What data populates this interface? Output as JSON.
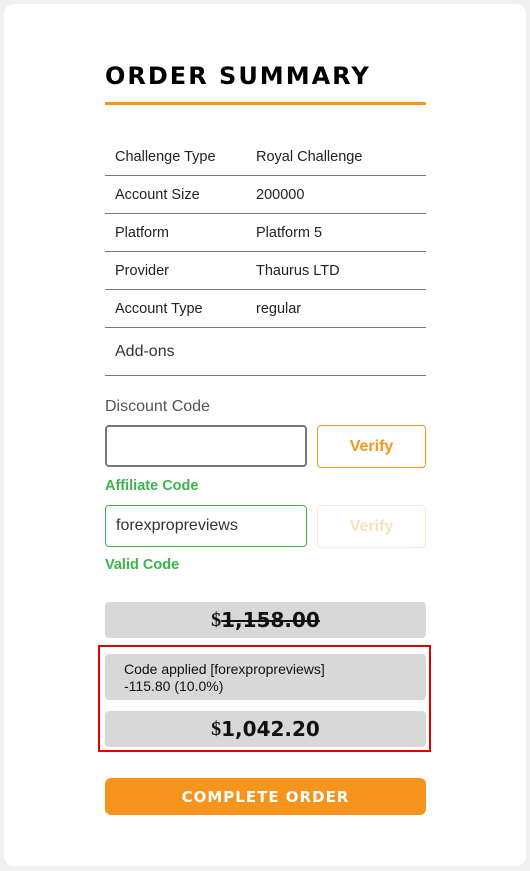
{
  "title": "ORDER SUMMARY",
  "summary_rows": [
    {
      "label": "Challenge Type",
      "value": "Royal Challenge"
    },
    {
      "label": "Account Size",
      "value": "200000"
    },
    {
      "label": "Platform",
      "value": "Platform 5"
    },
    {
      "label": "Provider",
      "value": "Thaurus LTD"
    },
    {
      "label": "Account Type",
      "value": "regular"
    }
  ],
  "addons_label": "Add-ons",
  "discount": {
    "label": "Discount Code",
    "value": "",
    "verify_label": "Verify"
  },
  "affiliate": {
    "label": "Affiliate Code",
    "value": "forexpropreviews",
    "verify_label": "Verify",
    "status": "Valid Code"
  },
  "pricing": {
    "currency_symbol": "$",
    "original": "1,158.00",
    "applied_line": "Code applied [forexpropreviews]",
    "discount_line": "-115.80 (10.0%)",
    "final": "1,042.20"
  },
  "complete_button": "COMPLETE ORDER",
  "colors": {
    "accent": "#f7941d",
    "success": "#3ab54a",
    "highlight": "#e00000"
  }
}
